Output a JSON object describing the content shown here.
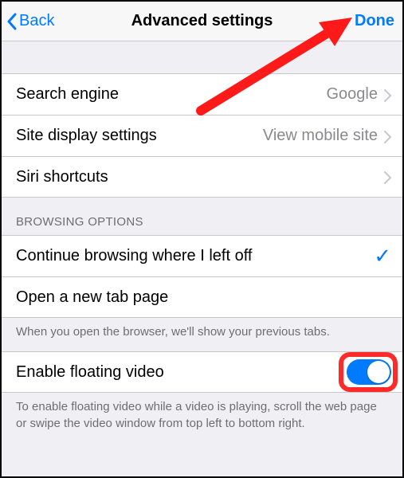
{
  "nav": {
    "back_label": "Back",
    "title": "Advanced settings",
    "done_label": "Done"
  },
  "rows": {
    "search_engine": {
      "label": "Search engine",
      "value": "Google"
    },
    "site_display": {
      "label": "Site display settings",
      "value": "View mobile site"
    },
    "siri": {
      "label": "Siri shortcuts"
    }
  },
  "browsing": {
    "header": "BROWSING OPTIONS",
    "continue_label": "Continue browsing where I left off",
    "new_tab_label": "Open a new tab page",
    "footer": "When you open the browser, we'll show your previous tabs."
  },
  "floating": {
    "label": "Enable floating video",
    "footer": "To enable floating video while a video is playing, scroll the web page or swipe the video window from top left to bottom right."
  }
}
